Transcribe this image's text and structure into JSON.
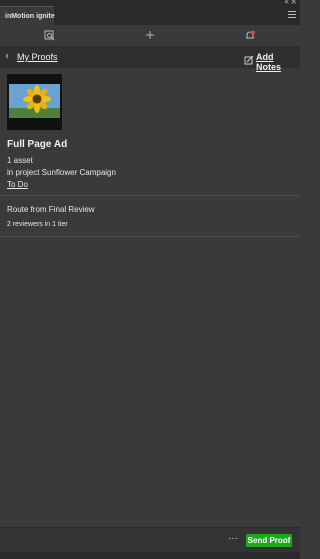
{
  "panel": {
    "tab_label": "inMotion ignite"
  },
  "nav": {
    "back_label": "My Proofs",
    "add_notes_label": "Add Notes"
  },
  "asset": {
    "title": "Full Page Ad",
    "count": "1 asset",
    "project": "in project Sunflower Campaign",
    "status": "To Do"
  },
  "route": {
    "name": "Route from Final Review",
    "reviewers": "2 reviewers in 1 tier"
  },
  "footer": {
    "more_label": "···",
    "send_label": "Send Proof"
  },
  "colors": {
    "panel_bg": "#3a3a3a",
    "accent_green": "#1ea81e",
    "alert_red": "#e0443a"
  },
  "icons": [
    "collapse-icon",
    "close-icon",
    "panel-menu-icon",
    "search-proof-icon",
    "add-icon",
    "notification-icon",
    "back-chevron-icon",
    "notes-icon",
    "more-icon"
  ]
}
